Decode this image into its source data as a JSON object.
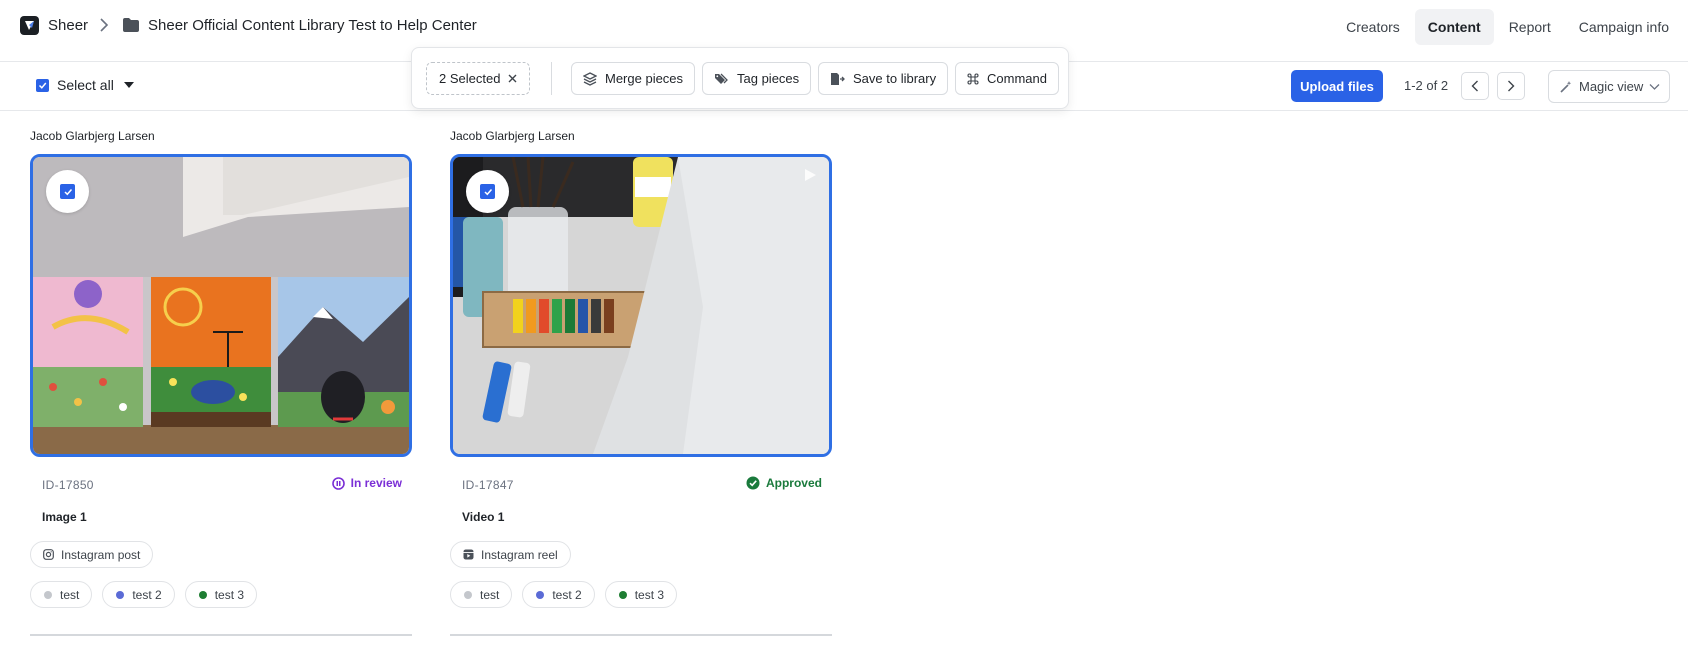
{
  "header": {
    "brand": "Sheer",
    "breadcrumb_title": "Sheer Official Content Library Test to Help Center",
    "nav": [
      {
        "label": "Creators",
        "active": false
      },
      {
        "label": "Content",
        "active": true
      },
      {
        "label": "Report",
        "active": false
      },
      {
        "label": "Campaign info",
        "active": false
      }
    ]
  },
  "toolbar": {
    "select_all_label": "Select all",
    "upload_label": "Upload files",
    "pager_text": "1-2 of 2",
    "view_label": "Magic view"
  },
  "selection_bar": {
    "selected_label": "2 Selected",
    "actions": [
      "Merge pieces",
      "Tag pieces",
      "Save to library",
      "Command"
    ]
  },
  "colors": {
    "accent": "#2a62e6",
    "in_review": "#7b2fd6",
    "approved": "#1a7a3c"
  },
  "cards": [
    {
      "creator": "Jacob Glarbjerg Larsen",
      "id": "ID-17850",
      "status": "In review",
      "title": "Image 1",
      "platform": "Instagram post",
      "platform_icon": "instagram-icon",
      "tags": [
        {
          "label": "test",
          "color": "#c4c7cc"
        },
        {
          "label": "test 2",
          "color": "#5b6bd6"
        },
        {
          "label": "test 3",
          "color": "#1e7d32"
        }
      ]
    },
    {
      "creator": "Jacob Glarbjerg Larsen",
      "id": "ID-17847",
      "status": "Approved",
      "title": "Video 1",
      "platform": "Instagram reel",
      "platform_icon": "reel-icon",
      "tags": [
        {
          "label": "test",
          "color": "#c4c7cc"
        },
        {
          "label": "test 2",
          "color": "#5b6bd6"
        },
        {
          "label": "test 3",
          "color": "#1e7d32"
        }
      ]
    }
  ]
}
